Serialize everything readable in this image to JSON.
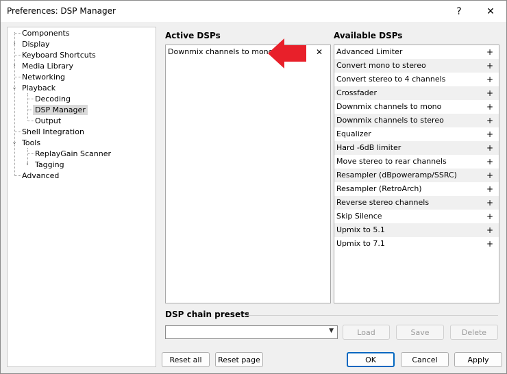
{
  "window": {
    "title": "Preferences: DSP Manager",
    "help_glyph": "?",
    "close_glyph": "✕"
  },
  "tree": {
    "items": [
      {
        "label": "Components"
      },
      {
        "label": "Display"
      },
      {
        "label": "Keyboard Shortcuts"
      },
      {
        "label": "Media Library"
      },
      {
        "label": "Networking"
      },
      {
        "label": "Playback"
      },
      {
        "label": "Decoding"
      },
      {
        "label": "DSP Manager"
      },
      {
        "label": "Output"
      },
      {
        "label": "Shell Integration"
      },
      {
        "label": "Tools"
      },
      {
        "label": "ReplayGain Scanner"
      },
      {
        "label": "Tagging"
      },
      {
        "label": "Advanced"
      }
    ],
    "glyph_collapsed": "›",
    "glyph_expanded": "⌄"
  },
  "active": {
    "title": "Active DSPs",
    "items": [
      {
        "label": "Downmix channels to mono",
        "remove_glyph": "✕"
      }
    ]
  },
  "available": {
    "title": "Available DSPs",
    "add_glyph": "+",
    "items": [
      {
        "label": "Advanced Limiter"
      },
      {
        "label": "Convert mono to stereo"
      },
      {
        "label": "Convert stereo to 4 channels"
      },
      {
        "label": "Crossfader"
      },
      {
        "label": "Downmix channels to mono"
      },
      {
        "label": "Downmix channels to stereo"
      },
      {
        "label": "Equalizer"
      },
      {
        "label": "Hard -6dB limiter"
      },
      {
        "label": "Move stereo to rear channels"
      },
      {
        "label": "Resampler (dBpoweramp/SSRC)"
      },
      {
        "label": "Resampler (RetroArch)"
      },
      {
        "label": "Reverse stereo channels"
      },
      {
        "label": "Skip Silence"
      },
      {
        "label": "Upmix to 5.1"
      },
      {
        "label": "Upmix to 7.1"
      }
    ]
  },
  "presets": {
    "title": "DSP chain presets",
    "selected": "",
    "load_label": "Load",
    "save_label": "Save",
    "delete_label": "Delete"
  },
  "footer": {
    "reset_all_label": "Reset all",
    "reset_page_label": "Reset page",
    "ok_label": "OK",
    "cancel_label": "Cancel",
    "apply_label": "Apply"
  },
  "colors": {
    "arrow": "#e8202a",
    "accent": "#0067c0",
    "selection": "#d9d9d9"
  }
}
